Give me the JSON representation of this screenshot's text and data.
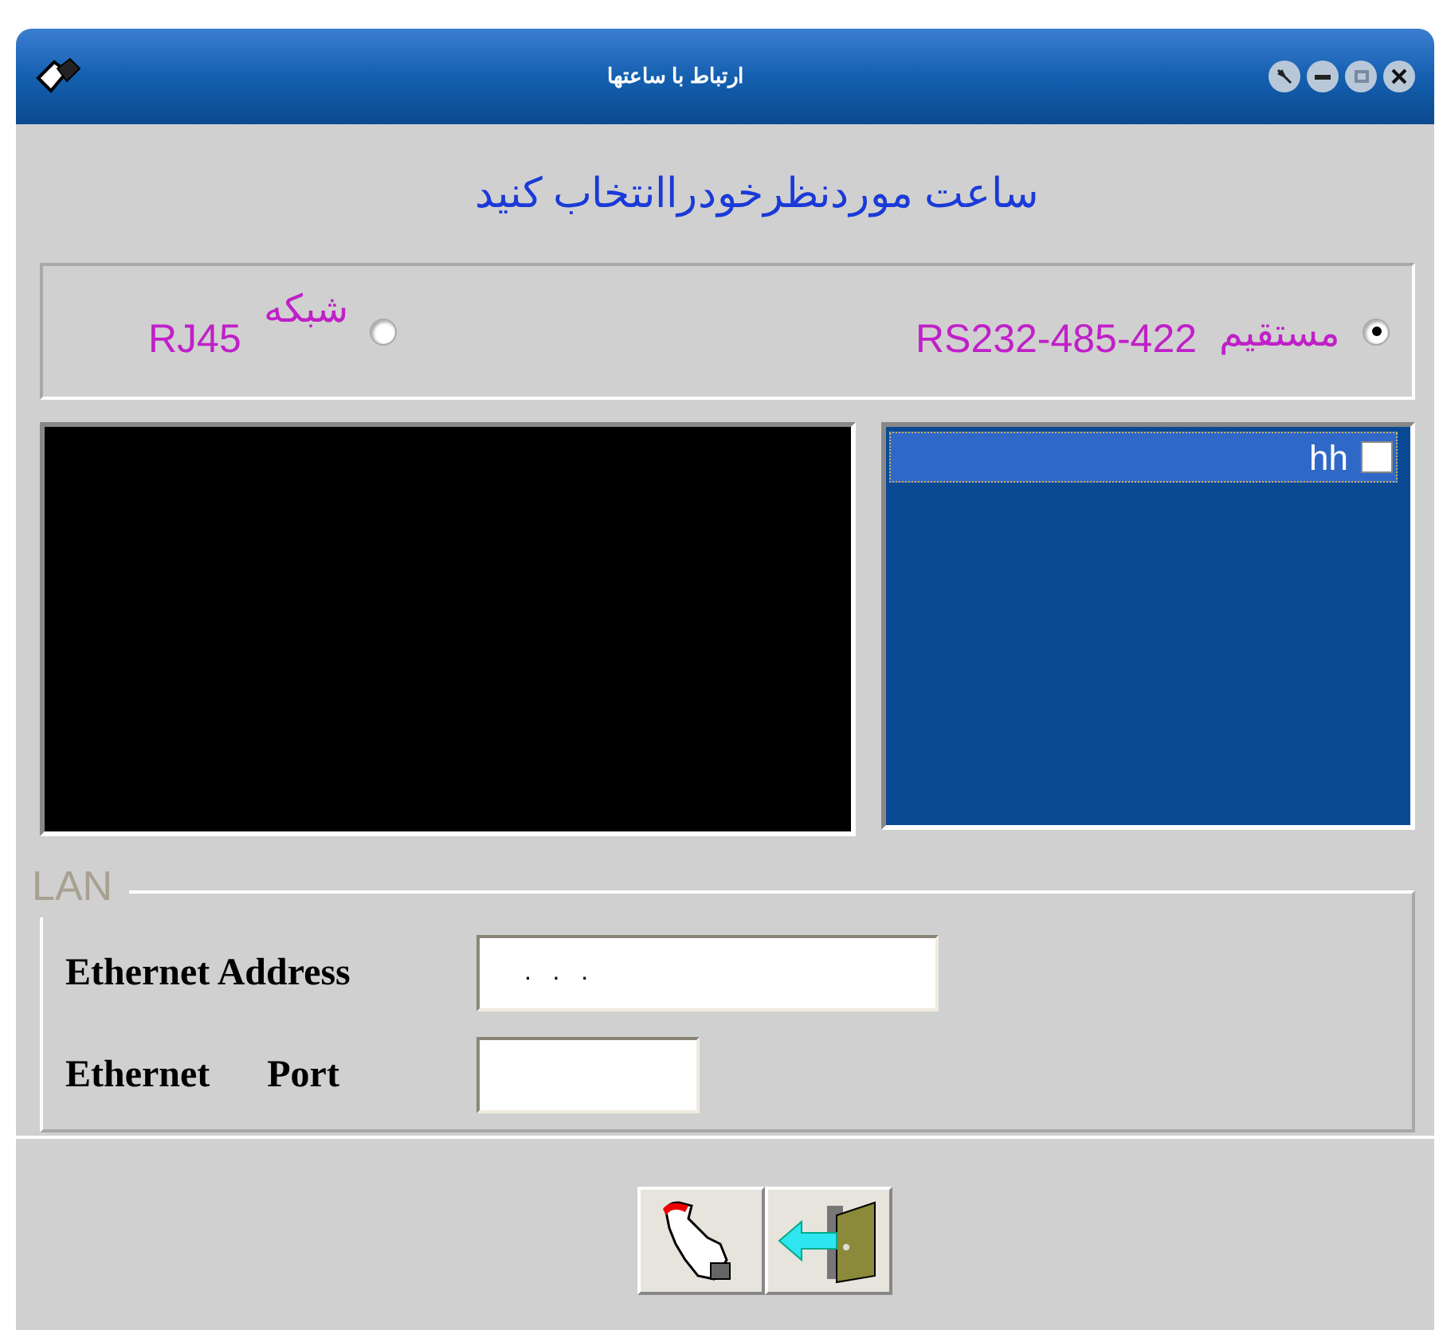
{
  "window": {
    "title": "ارتباط با ساعتها"
  },
  "heading": "ساعت موردنظرخودراانتخاب کنید",
  "connection": [
    {
      "label": "مستقیم",
      "detail": "RS232-485-422",
      "selected": true
    },
    {
      "label": "شبکه",
      "detail": "RJ45",
      "selected": false
    }
  ],
  "clocks": [
    {
      "name": "hh",
      "checked": false,
      "selected": true
    }
  ],
  "lan": {
    "legend": "LAN",
    "fields": [
      {
        "label": "Ethernet Address",
        "value": ".   .   ."
      },
      {
        "label": "Ethernet      Port"
      }
    ]
  },
  "buttons": [
    {
      "kind": "connect"
    },
    {
      "kind": "exit"
    }
  ]
}
